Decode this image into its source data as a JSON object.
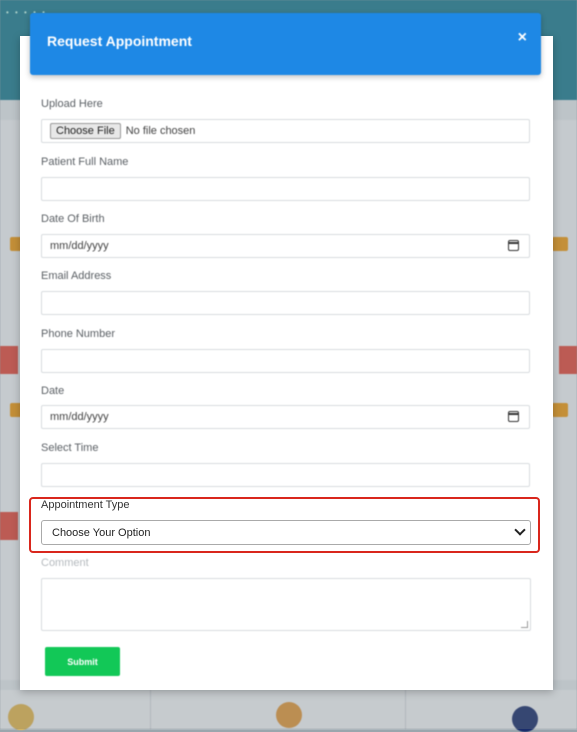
{
  "background_page": {
    "topbar_dots": "• • • • •"
  },
  "modal": {
    "title": "Request Appointment",
    "close_glyph": "×",
    "upload": {
      "label": "Upload Here",
      "button": "Choose File",
      "status": "No file chosen"
    },
    "patient_name": {
      "label": "Patient Full Name",
      "value": ""
    },
    "dob": {
      "label": "Date Of Birth",
      "placeholder": "mm/dd/yyyy"
    },
    "email": {
      "label": "Email Address",
      "value": ""
    },
    "phone": {
      "label": "Phone Number",
      "value": ""
    },
    "date": {
      "label": "Date",
      "placeholder": "mm/dd/yyyy"
    },
    "time": {
      "label": "Select Time",
      "value": ""
    },
    "appointment_type": {
      "label": "Appointment Type",
      "selected": "Choose Your Option"
    },
    "comment": {
      "label": "Comment",
      "value": ""
    },
    "submit_label": "Submit"
  },
  "colors": {
    "header_blue": "#1e88e5",
    "highlight_red": "#d9261c",
    "submit_green": "#12c857"
  }
}
